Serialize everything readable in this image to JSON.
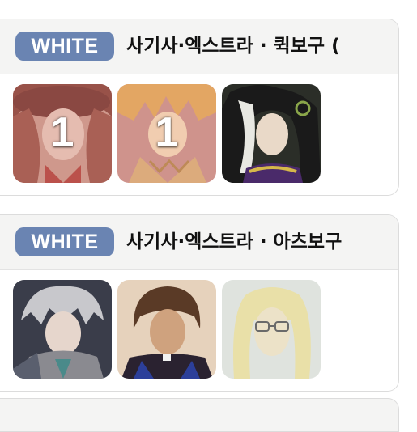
{
  "cards": [
    {
      "badge": "WHITE",
      "title": "사기사·엑스트라 · 퀵보구 (",
      "colors": {
        "badge": "#6a84b2"
      },
      "items": [
        {
          "avatar": "red-haired-servant-portrait",
          "count": "1"
        },
        {
          "avatar": "orange-haired-servant-portrait",
          "count": "1"
        },
        {
          "avatar": "black-white-haired-servant-portrait",
          "count": ""
        }
      ]
    },
    {
      "badge": "WHITE",
      "title": "사기사·엑스트라 · 아츠보구",
      "colors": {
        "badge": "#6a84b2"
      },
      "items": [
        {
          "avatar": "silver-haired-servant-portrait",
          "count": ""
        },
        {
          "avatar": "brown-haired-priest-portrait",
          "count": ""
        },
        {
          "avatar": "blonde-glasses-servant-portrait",
          "count": ""
        }
      ]
    }
  ]
}
